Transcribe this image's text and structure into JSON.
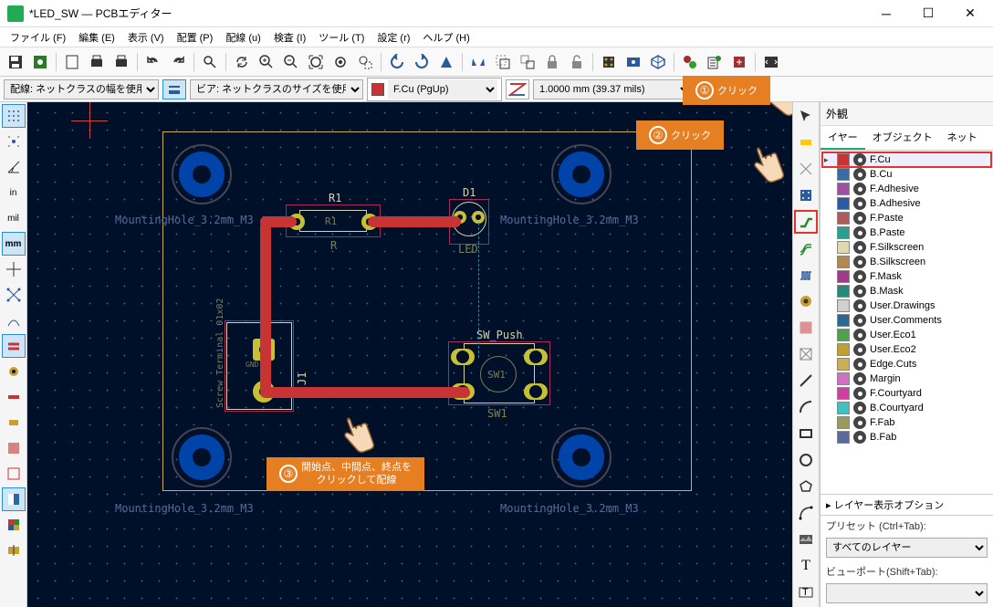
{
  "window": {
    "title": "*LED_SW — PCBエディター"
  },
  "menus": [
    "ファイル (F)",
    "編集 (E)",
    "表示 (V)",
    "配置 (P)",
    "配線 (u)",
    "検査 (I)",
    "ツール (T)",
    "設定 (r)",
    "ヘルプ (H)"
  ],
  "toolbar2": {
    "track_width": "配線: ネットクラスの幅を使用",
    "via_size": "ビア: ネットクラスのサイズを使用",
    "layer": "F.Cu (PgUp)",
    "grid": "1.0000 mm (39.37 mils)"
  },
  "callouts": {
    "c1": {
      "num": "①",
      "text": "クリック"
    },
    "c2": {
      "num": "②",
      "text": "クリック"
    },
    "c3": {
      "num": "③",
      "line1": "開始点、中間点、終点を",
      "line2": "クリックして配線"
    }
  },
  "board": {
    "mh": "MountingHole_3.2mm_M3",
    "r1": "R1",
    "r": "R",
    "d1": "D1",
    "led": "LED",
    "sw_push": "SW_Push",
    "sw1": "SW1",
    "j1": "J1",
    "screw_term": "Screw_Terminal_01x02",
    "gnd": "GND"
  },
  "appearance": {
    "title": "外観",
    "tabs": [
      "イヤー",
      "オブジェクト",
      "ネット"
    ],
    "layers": [
      {
        "name": "F.Cu",
        "color": "#c83434",
        "sel": true,
        "hl": true
      },
      {
        "name": "B.Cu",
        "color": "#3a6aa8"
      },
      {
        "name": "F.Adhesive",
        "color": "#a050a0"
      },
      {
        "name": "B.Adhesive",
        "color": "#2a5aa0"
      },
      {
        "name": "F.Paste",
        "color": "#b05a5a"
      },
      {
        "name": "B.Paste",
        "color": "#2aa090"
      },
      {
        "name": "F.Silkscreen",
        "color": "#e0d8b0"
      },
      {
        "name": "B.Silkscreen",
        "color": "#b08850"
      },
      {
        "name": "F.Mask",
        "color": "#a03a8a"
      },
      {
        "name": "B.Mask",
        "color": "#2a887a"
      },
      {
        "name": "User.Drawings",
        "color": "#d0d0d0"
      },
      {
        "name": "User.Comments",
        "color": "#2a6a90"
      },
      {
        "name": "User.Eco1",
        "color": "#50a050"
      },
      {
        "name": "User.Eco2",
        "color": "#c0a030"
      },
      {
        "name": "Edge.Cuts",
        "color": "#ccae54"
      },
      {
        "name": "Margin",
        "color": "#d070c0"
      },
      {
        "name": "F.Courtyard",
        "color": "#d040a0"
      },
      {
        "name": "B.Courtyard",
        "color": "#40c0c0"
      },
      {
        "name": "F.Fab",
        "color": "#9a9a60"
      },
      {
        "name": "B.Fab",
        "color": "#5a6a9a"
      }
    ],
    "disp_options": "レイヤー表示オプション",
    "preset_label": "プリセット (Ctrl+Tab):",
    "preset_value": "すべてのレイヤー",
    "viewport_label": "ビューポート(Shift+Tab):"
  }
}
